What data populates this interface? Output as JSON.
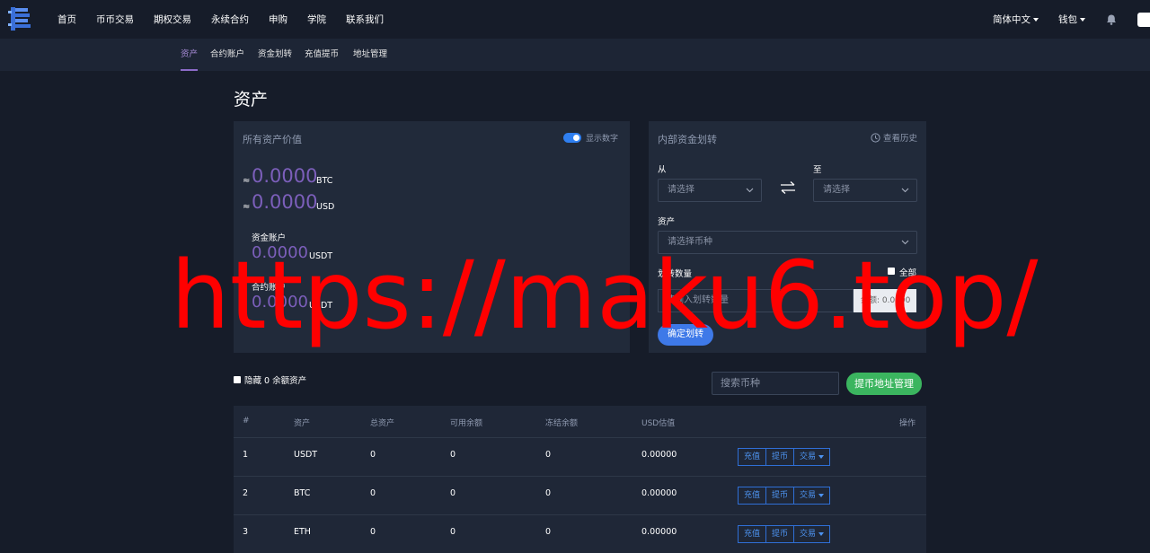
{
  "header": {
    "nav": [
      "首页",
      "币币交易",
      "期权交易",
      "永续合约",
      "申购",
      "学院",
      "联系我们"
    ],
    "language": "简体中文",
    "wallet": "钱包"
  },
  "subnav": {
    "items": [
      "资产",
      "合约账户",
      "资金划转",
      "充值提币",
      "地址管理"
    ]
  },
  "page_title": "资产",
  "assets_panel": {
    "title": "所有资产价值",
    "toggle_label": "显示数字",
    "approx": "≈",
    "btc_value": "0.0000",
    "btc_unit": "BTC",
    "usd_value": "0.0000",
    "usd_unit": "USD",
    "fund_account_label": "资金账户",
    "fund_account_value": "0.0000",
    "fund_account_unit": "USDT",
    "contract_account_label": "合约账户",
    "contract_account_value": "0.0000",
    "contract_account_unit": "USDT"
  },
  "transfer_panel": {
    "title": "内部资金划转",
    "history": "查看历史",
    "from_label": "从",
    "from_placeholder": "请选择",
    "to_label": "至",
    "to_placeholder": "请选择",
    "asset_label": "资产",
    "asset_placeholder": "请选择币种",
    "amount_label": "划转数量",
    "all_label": "全部",
    "amount_placeholder": "请输入划转数量",
    "balance_text": "余额: 0.0000",
    "confirm": "确定划转"
  },
  "list_controls": {
    "hide_zero": "隐藏 0 余额资产",
    "search_placeholder": "搜索币种",
    "address_button": "提币地址管理"
  },
  "table": {
    "headers": [
      "#",
      "资产",
      "总资产",
      "可用余额",
      "冻结余额",
      "USD估值",
      "操作"
    ],
    "rows": [
      {
        "no": "1",
        "asset": "USDT",
        "total": "0",
        "available": "0",
        "frozen": "0",
        "usd": "0.00000"
      },
      {
        "no": "2",
        "asset": "BTC",
        "total": "0",
        "available": "0",
        "frozen": "0",
        "usd": "0.00000"
      },
      {
        "no": "3",
        "asset": "ETH",
        "total": "0",
        "available": "0",
        "frozen": "0",
        "usd": "0.00000"
      }
    ],
    "actions": {
      "deposit": "充值",
      "withdraw": "提币",
      "trade": "交易"
    }
  },
  "watermark": "https://maku6.top/",
  "colors": {
    "accent_purple": "#7c5fbb",
    "primary_blue": "#3e79e8",
    "green": "#3bb55f",
    "background": "#161c29"
  }
}
